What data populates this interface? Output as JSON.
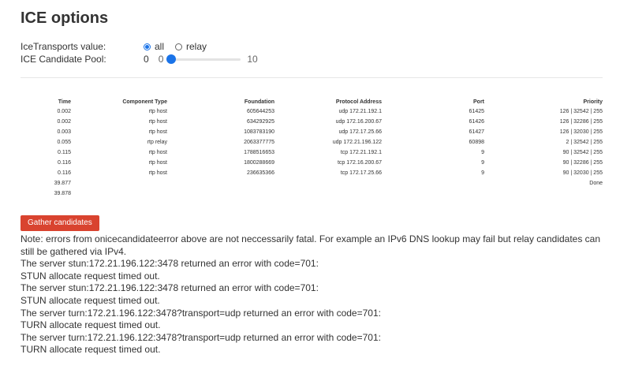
{
  "title": "ICE options",
  "ice_transports": {
    "label": "IceTransports value:",
    "options": [
      {
        "label": "all",
        "checked": true
      },
      {
        "label": "relay",
        "checked": false
      }
    ]
  },
  "candidate_pool": {
    "label": "ICE Candidate Pool:",
    "value": "0",
    "min": "0",
    "max": "10",
    "level": 0
  },
  "table": {
    "headers": {
      "time": "Time",
      "component": "Component Type",
      "foundation": "Foundation",
      "protocol": "Protocol Address",
      "port": "Port",
      "priority": "Priority"
    },
    "rows": [
      {
        "time": "0.002",
        "component": "rtp host",
        "foundation": "605644253",
        "protocol": "udp 172.21.192.1",
        "port": "61425",
        "priority": "126 | 32542 | 255"
      },
      {
        "time": "0.002",
        "component": "rtp host",
        "foundation": "634292925",
        "protocol": "udp 172.16.200.67",
        "port": "61426",
        "priority": "126 | 32286 | 255"
      },
      {
        "time": "0.003",
        "component": "rtp host",
        "foundation": "1083783190",
        "protocol": "udp 172.17.25.66",
        "port": "61427",
        "priority": "126 | 32030 | 255"
      },
      {
        "time": "0.055",
        "component": "rtp relay",
        "foundation": "2063377775",
        "protocol": "udp 172.21.196.122",
        "port": "60898",
        "priority": "2 | 32542 | 255"
      },
      {
        "time": "0.115",
        "component": "rtp host",
        "foundation": "1788516653",
        "protocol": "tcp 172.21.192.1",
        "port": "9",
        "priority": "90 | 32542 | 255"
      },
      {
        "time": "0.116",
        "component": "rtp host",
        "foundation": "1800288669",
        "protocol": "tcp 172.16.200.67",
        "port": "9",
        "priority": "90 | 32286 | 255"
      },
      {
        "time": "0.116",
        "component": "rtp host",
        "foundation": "236635366",
        "protocol": "tcp 172.17.25.66",
        "port": "9",
        "priority": "90 | 32030 | 255"
      },
      {
        "time": "39.877",
        "component": "",
        "foundation": "",
        "protocol": "",
        "port": "",
        "priority": "Done"
      },
      {
        "time": "39.878",
        "component": "",
        "foundation": "",
        "protocol": "",
        "port": "",
        "priority": ""
      }
    ]
  },
  "gather_button": "Gather candidates",
  "log_lines": [
    "Note: errors from onicecandidateerror above are not neccessarily fatal. For example an IPv6 DNS lookup may fail but relay candidates can still be gathered via IPv4.",
    "The server stun:172.21.196.122:3478 returned an error with code=701:",
    "STUN allocate request timed out.",
    "The server stun:172.21.196.122:3478 returned an error with code=701:",
    "STUN allocate request timed out.",
    "The server turn:172.21.196.122:3478?transport=udp returned an error with code=701:",
    "TURN allocate request timed out.",
    "The server turn:172.21.196.122:3478?transport=udp returned an error with code=701:",
    "TURN allocate request timed out."
  ],
  "colors": {
    "accent": "#1a73e8",
    "button": "#d9432f"
  }
}
